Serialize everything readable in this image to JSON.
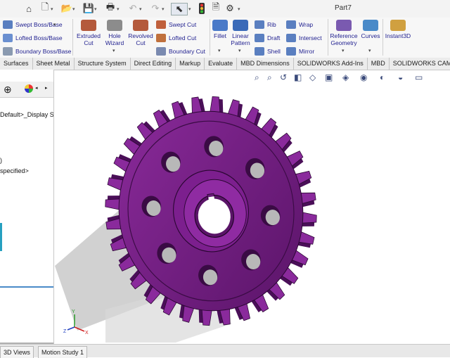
{
  "window": {
    "title": "Part7"
  },
  "quick_access": {
    "icons": [
      "home-icon",
      "new-document-icon",
      "open-folder-icon",
      "save-icon",
      "print-icon",
      "undo-icon",
      "redo-icon",
      "select-arrow-icon",
      "traffic-light-icon",
      "file-properties-icon",
      "gear-icon"
    ]
  },
  "ribbon": {
    "boss_features": [
      "Swept Boss/Base",
      "Lofted Boss/Base",
      "Boundary Boss/Base"
    ],
    "extruded_cut": "Extruded\nCut",
    "hole_wizard": "Hole\nWizard",
    "revolved_cut": "Revolved\nCut",
    "cut_features": [
      "Swept Cut",
      "Lofted Cut",
      "Boundary Cut"
    ],
    "fillet": "Fillet",
    "linear_pattern": "Linear\nPattern",
    "misc_features": [
      "Rib",
      "Draft",
      "Shell"
    ],
    "wrap_features": [
      "Wrap",
      "Intersect",
      "Mirror"
    ],
    "reference_geometry": "Reference\nGeometry",
    "curves": "Curves",
    "instant3d": "Instant3D"
  },
  "command_tabs": [
    "Surfaces",
    "Sheet Metal",
    "Structure System",
    "Direct Editing",
    "Markup",
    "Evaluate",
    "MBD Dimensions",
    "SOLIDWORKS Add-Ins",
    "MBD",
    "SOLIDWORKS CAM"
  ],
  "feature_tree": {
    "lines": [
      "Default>_Display Sta",
      ")",
      "specified>"
    ]
  },
  "bottom_tabs": [
    "3D Views",
    "Motion Study 1"
  ],
  "colors": {
    "part": "#7a1f8a",
    "part_dark": "#3e0a48",
    "accent": "#1f1f8f"
  }
}
